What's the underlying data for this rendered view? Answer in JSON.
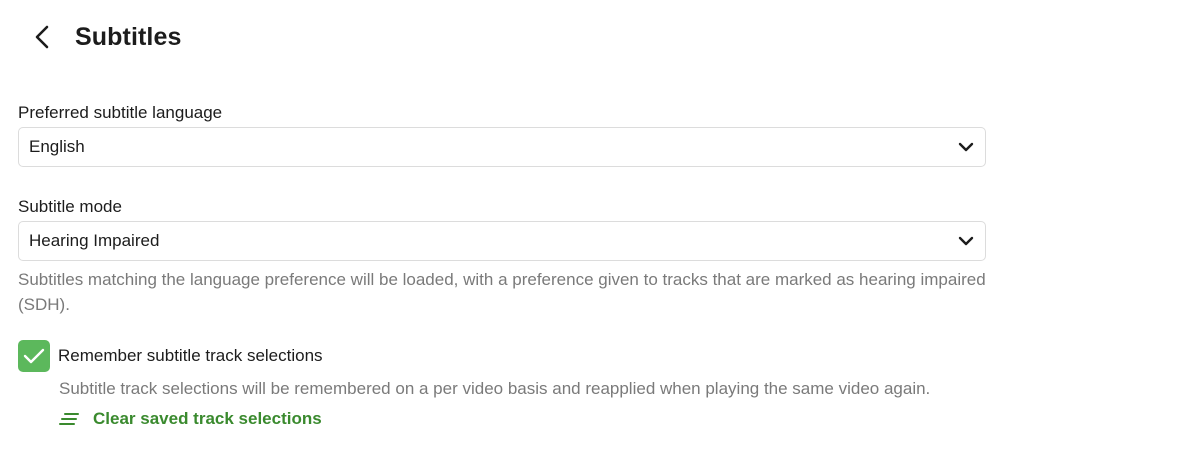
{
  "header": {
    "back_icon": "chevron-left-icon",
    "title": "Subtitles"
  },
  "language": {
    "label": "Preferred subtitle language",
    "value": "English",
    "chevron_icon": "chevron-down-icon"
  },
  "mode": {
    "label": "Subtitle mode",
    "value": "Hearing Impaired",
    "chevron_icon": "chevron-down-icon",
    "help": "Subtitles matching the language preference will be loaded, with a preference given to tracks that are marked as hearing impaired (SDH)."
  },
  "remember": {
    "checked": true,
    "check_color": "#5cb85c",
    "label": "Remember subtitle track selections",
    "help": "Subtitle track selections will be remembered on a per video basis and reapplied when playing the same video again."
  },
  "clear": {
    "icon": "clear-lines-icon",
    "label": "Clear saved track selections",
    "color": "#3a8a2e"
  }
}
